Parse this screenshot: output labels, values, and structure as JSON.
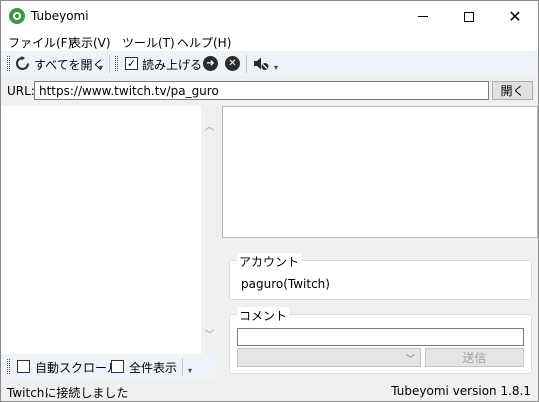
{
  "window": {
    "title": "Tubeyomi"
  },
  "title_controls": {
    "minimize_icon": "minimize-icon",
    "maximize_icon": "maximize-icon",
    "close_icon": "close-icon"
  },
  "menu": [
    {
      "label": "ファイル(F)"
    },
    {
      "label": "表示(V)"
    },
    {
      "label": "ツール(T)"
    },
    {
      "label": "ヘルプ(H)"
    }
  ],
  "toolbar": {
    "open_all_label": "すべてを開く",
    "read_aloud_label": "読み上げる",
    "read_aloud_checked": true,
    "refresh_icon": "refresh-icon",
    "next_icon": "arrow-right-circle-icon",
    "stop_icon": "x-circle-icon",
    "mute_icon": "speaker-mute-icon"
  },
  "url_bar": {
    "label": "URL:",
    "value": "https://www.twitch.tv/pa_guro",
    "open_button": "開く"
  },
  "bottom_toolbar": {
    "auto_scroll_label": "自動スクロール",
    "show_all_label": "全件表示"
  },
  "account": {
    "group_label": "アカウント",
    "name": "paguro(Twitch)"
  },
  "comment": {
    "group_label": "コメント",
    "input_value": "",
    "send_button": "送信"
  },
  "status": {
    "message": "Twitchに接続しました",
    "version": "Tubeyomi version 1.8.1"
  },
  "colors": {
    "toolbar_bg": "#eef3fa",
    "app_icon": "#3a9a44"
  }
}
